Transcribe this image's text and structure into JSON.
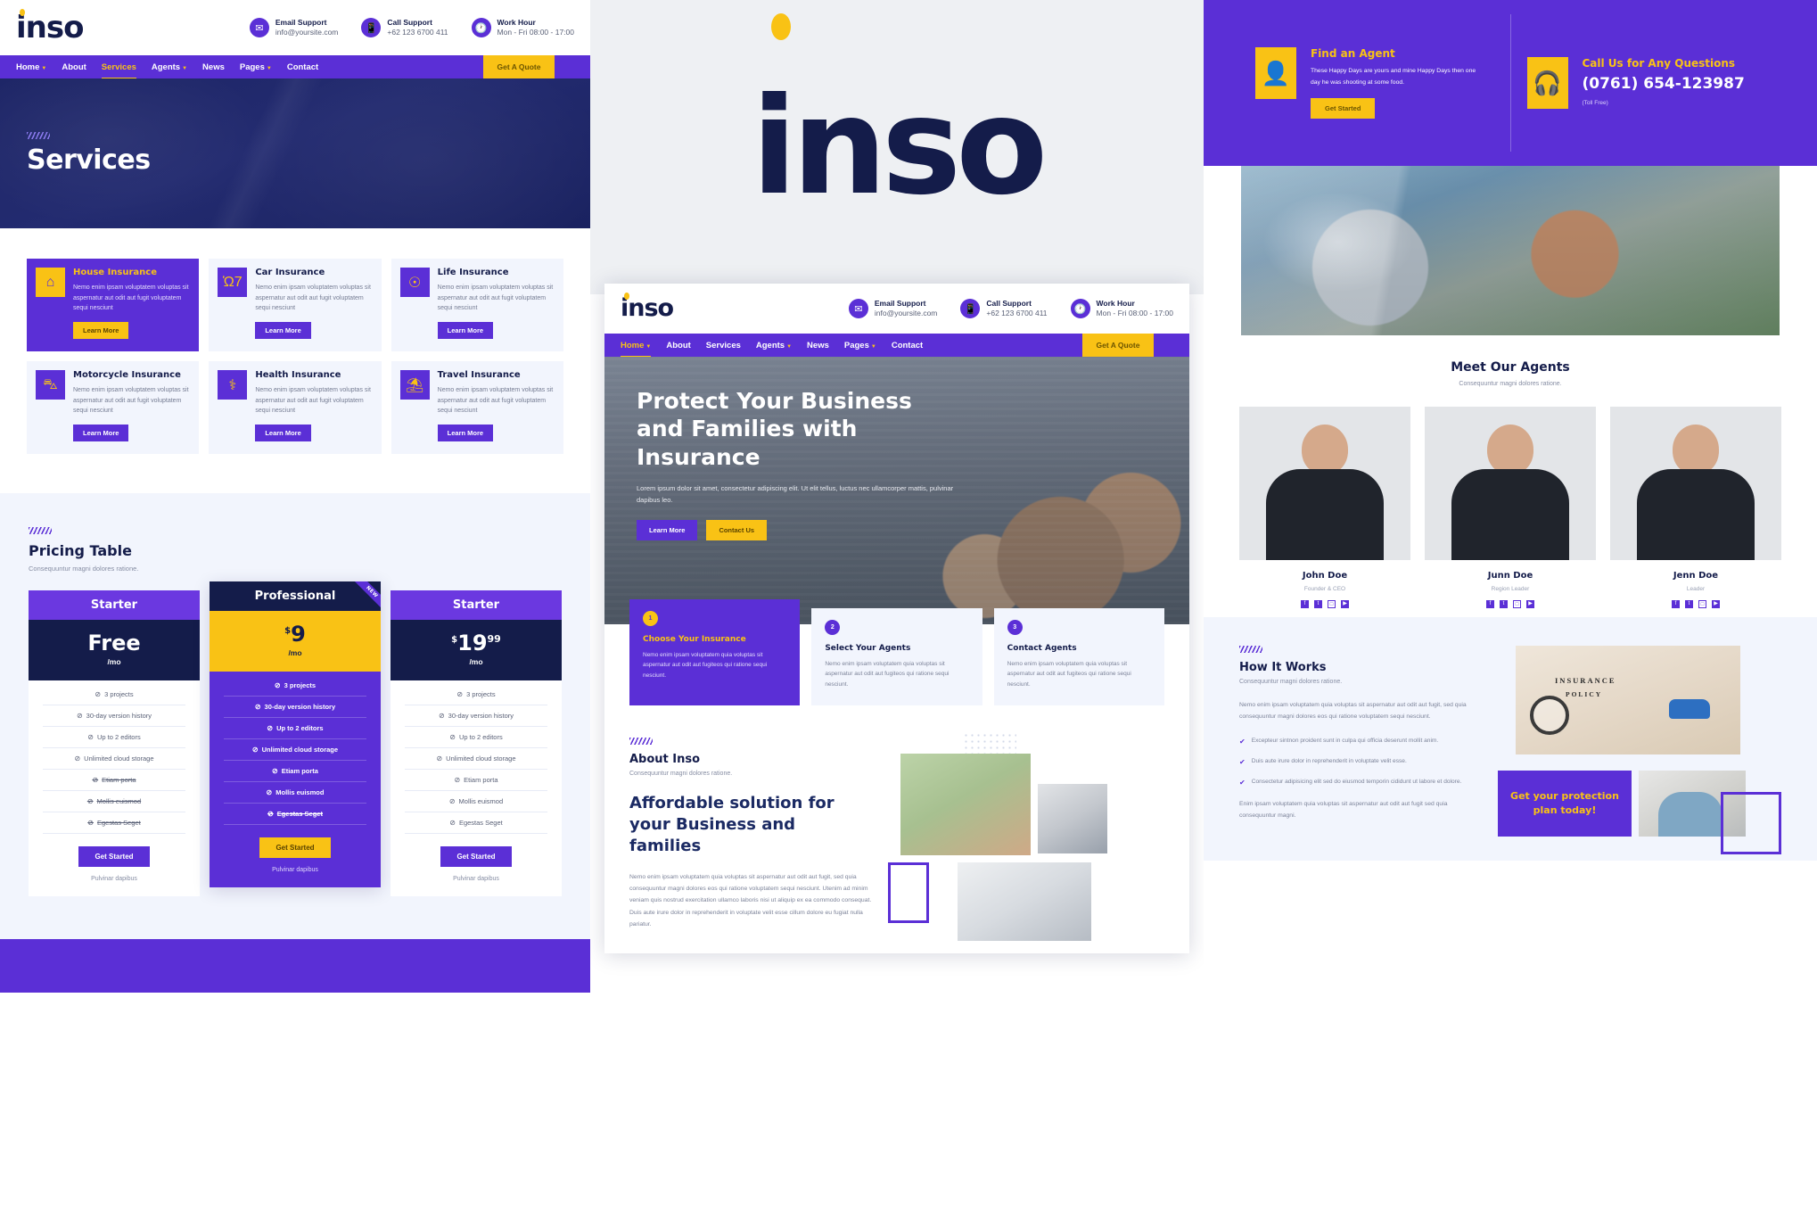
{
  "brand": {
    "name": "inso"
  },
  "topbar": {
    "contacts": [
      {
        "icon": "envelope-icon",
        "label": "Email Support",
        "value": "info@yoursite.com"
      },
      {
        "icon": "phone-icon",
        "label": "Call Support",
        "value": "+62 123 6700 411"
      },
      {
        "icon": "clock-icon",
        "label": "Work Hour",
        "value": "Mon - Fri 08:00 - 17:00"
      }
    ]
  },
  "nav": {
    "items": [
      {
        "label": "Home",
        "caret": true,
        "active": false
      },
      {
        "label": "About",
        "caret": false,
        "active": false
      },
      {
        "label": "Services",
        "caret": false,
        "active": true
      },
      {
        "label": "Agents",
        "caret": true,
        "active": false
      },
      {
        "label": "News",
        "caret": false,
        "active": false
      },
      {
        "label": "Pages",
        "caret": true,
        "active": false
      },
      {
        "label": "Contact",
        "caret": false,
        "active": false
      }
    ],
    "quote_button": "Get A Quote"
  },
  "nav_mid": {
    "items": [
      {
        "label": "Home",
        "caret": true,
        "active": true
      },
      {
        "label": "About",
        "caret": false,
        "active": false
      },
      {
        "label": "Services",
        "caret": false,
        "active": false
      },
      {
        "label": "Agents",
        "caret": true,
        "active": false
      },
      {
        "label": "News",
        "caret": false,
        "active": false
      },
      {
        "label": "Pages",
        "caret": true,
        "active": false
      },
      {
        "label": "Contact",
        "caret": false,
        "active": false
      }
    ],
    "quote_button": "Get A Quote"
  },
  "services_page": {
    "hero_title": "Services",
    "cards": [
      {
        "icon": "house-icon",
        "glyph": "⌂",
        "title": "House Insurance",
        "desc": "Nemo enim ipsam voluptatem voluptas sit aspernatur aut odit aut fugit voluptatem sequi nesciunt",
        "button": "Learn More",
        "highlight": true
      },
      {
        "icon": "car-icon",
        "glyph": "Ὡ7",
        "title": "Car Insurance",
        "desc": "Nemo enim ipsam voluptatem voluptas sit aspernatur aut odit aut fugit voluptatem sequi nesciunt",
        "button": "Learn More",
        "highlight": false
      },
      {
        "icon": "lifebuoy-icon",
        "glyph": "☉",
        "title": "Life Insurance",
        "desc": "Nemo enim ipsam voluptatem voluptas sit aspernatur aut odit aut fugit voluptatem sequi nesciunt",
        "button": "Learn More",
        "highlight": false
      },
      {
        "icon": "motorcycle-icon",
        "glyph": "⛍",
        "title": "Motorcycle Insurance",
        "desc": "Nemo enim ipsam voluptatem voluptas sit aspernatur aut odit aut fugit voluptatem sequi nesciunt",
        "button": "Learn More",
        "highlight": false
      },
      {
        "icon": "health-icon",
        "glyph": "⚕",
        "title": "Health Insurance",
        "desc": "Nemo enim ipsam voluptatem voluptas sit aspernatur aut odit aut fugit voluptatem sequi nesciunt",
        "button": "Learn More",
        "highlight": false
      },
      {
        "icon": "travel-icon",
        "glyph": "⛱",
        "title": "Travel Insurance",
        "desc": "Nemo enim ipsam voluptatem voluptas sit aspernatur aut odit aut fugit voluptatem sequi nesciunt",
        "button": "Learn More",
        "highlight": false
      }
    ]
  },
  "pricing": {
    "title": "Pricing Table",
    "subtitle": "Consequuntur magni dolores ratione.",
    "ribbon": "NEW",
    "plans": [
      {
        "name": "Starter",
        "currency": "",
        "amount": "Free",
        "cents": "",
        "period": "/mo",
        "features": [
          {
            "text": "3 projects",
            "strike": false
          },
          {
            "text": "30-day version history",
            "strike": false
          },
          {
            "text": "Up to 2 editors",
            "strike": false
          },
          {
            "text": "Unlimited cloud storage",
            "strike": false
          },
          {
            "text": "Etiam porta",
            "strike": true
          },
          {
            "text": "Mollis euismod",
            "strike": true
          },
          {
            "text": "Egestas Seget",
            "strike": true
          }
        ],
        "cta": "Get Started",
        "note": "Pulvinar dapibus"
      },
      {
        "name": "Professional",
        "currency": "$",
        "amount": "9",
        "cents": "",
        "period": "/mo",
        "features": [
          {
            "text": "3 projects",
            "strike": false
          },
          {
            "text": "30-day version history",
            "strike": false
          },
          {
            "text": "Up to 2 editors",
            "strike": false
          },
          {
            "text": "Unlimited cloud storage",
            "strike": false
          },
          {
            "text": "Etiam porta",
            "strike": false
          },
          {
            "text": "Mollis euismod",
            "strike": false
          },
          {
            "text": "Egestas Seget",
            "strike": true
          }
        ],
        "cta": "Get Started",
        "note": "Pulvinar dapibus"
      },
      {
        "name": "Starter",
        "currency": "$",
        "amount": "19",
        "cents": "99",
        "period": "/mo",
        "features": [
          {
            "text": "3 projects",
            "strike": false
          },
          {
            "text": "30-day version history",
            "strike": false
          },
          {
            "text": "Up to 2 editors",
            "strike": false
          },
          {
            "text": "Unlimited cloud storage",
            "strike": false
          },
          {
            "text": "Etiam porta",
            "strike": false
          },
          {
            "text": "Mollis euismod",
            "strike": false
          },
          {
            "text": "Egestas Seget",
            "strike": false
          }
        ],
        "cta": "Get Started",
        "note": "Pulvinar dapibus"
      }
    ]
  },
  "home_page": {
    "hero": {
      "title": "Protect Your Business and Families with Insurance",
      "desc": "Lorem ipsum dolor sit amet, consectetur adipiscing elit. Ut elit tellus, luctus nec ullamcorper mattis, pulvinar dapibus leo.",
      "btn_primary": "Learn More",
      "btn_secondary": "Contact Us"
    },
    "steps": [
      {
        "num": "1",
        "title": "Choose Your Insurance",
        "desc": "Nemo enim ipsam voluptatem quia voluptas sit aspernatur aut odit aut fugiteos qui ratione sequi nesciunt.",
        "highlight": true
      },
      {
        "num": "2",
        "title": "Select Your Agents",
        "desc": "Nemo enim ipsam voluptatem quia voluptas sit aspernatur aut odit aut fugiteos qui ratione sequi nesciunt.",
        "highlight": false
      },
      {
        "num": "3",
        "title": "Contact Agents",
        "desc": "Nemo enim ipsam voluptatem quia voluptas sit aspernatur aut odit aut fugiteos qui ratione sequi nesciunt.",
        "highlight": false
      }
    ],
    "about": {
      "kicker": "About Inso",
      "subtitle": "Consequuntur magni dolores ratione.",
      "headline": "Affordable solution for your Business and families",
      "paragraph": "Nemo enim ipsam voluptatem quia voluptas sit aspernatur aut odit aut fugit, sed quia consequuntur magni dolores eos qui ratione voluptatem sequi nesciunt. Utenim ad minim veniam quis nostrud exercitation ullamco laboris nisi ut aliquip ex ea commodo consequat. Duis aute irure dolor in reprehenderit in voluptate velit esse cillum dolore eu fugiat nulla pariatur."
    }
  },
  "right_page": {
    "cta_left": {
      "icon": "agent-icon",
      "title": "Find an Agent",
      "text": "These Happy Days are yours and mine Happy Days then one day he was shooting at some food.",
      "button": "Get Started"
    },
    "cta_right": {
      "icon": "headset-icon",
      "title": "Call Us for Any Questions",
      "phone": "(0761) 654-123987",
      "toll": "(Toll Free)"
    },
    "agents": {
      "title": "Meet Our Agents",
      "subtitle": "Consequuntur magni dolores ratione.",
      "list": [
        {
          "name": "John Doe",
          "role": "Founder & CEO"
        },
        {
          "name": "Junn Doe",
          "role": "Region Leader"
        },
        {
          "name": "Jenn Doe",
          "role": "Leader"
        }
      ],
      "socials": [
        "facebook-icon",
        "twitter-icon",
        "instagram-icon",
        "youtube-icon"
      ]
    },
    "how": {
      "title": "How It Works",
      "subtitle": "Consequuntur magni dolores ratione.",
      "paragraph": "Nemo enim ipsam voluptatem quia voluptas sit aspernatur aut odit aut fugit, sed quia consequuntur magni dolores eos qui ratione voluptatem sequi nesciunt.",
      "bullets": [
        "Excepteur sintnon proident sunt in culpa qui officia deserunt mollit anim.",
        "Duis aute irure dolor in reprehenderit in voluptate velit esse.",
        "Consectetur adipisicing elit sed do eiusmod temporin cididunt ut labore et dolore."
      ],
      "paragraph2": "Enim ipsam voluptatem quia voluptas sit aspernatur aut odit aut fugit sed quia consequuntur magni.",
      "policy_line1": "INSURANCE",
      "policy_line2": "POLICY",
      "cta_text": "Get your protection plan today!"
    }
  }
}
